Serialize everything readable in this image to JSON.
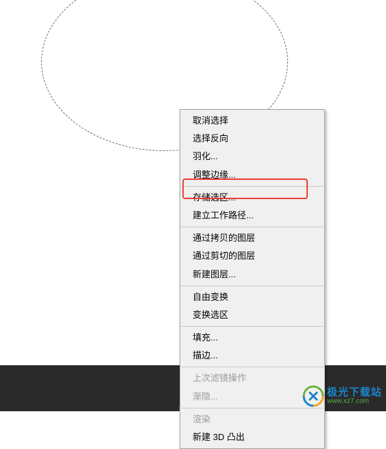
{
  "menu": {
    "items": [
      {
        "label": "取消选择",
        "disabled": false
      },
      {
        "label": "选择反向",
        "disabled": false
      },
      {
        "label": "羽化...",
        "disabled": false
      },
      {
        "label": "调整边缘...",
        "disabled": false
      },
      {
        "sep": true
      },
      {
        "label": "存储选区...",
        "disabled": false
      },
      {
        "label": "建立工作路径...",
        "disabled": false,
        "highlighted": true
      },
      {
        "sep": true
      },
      {
        "label": "通过拷贝的图层",
        "disabled": false
      },
      {
        "label": "通过剪切的图层",
        "disabled": false
      },
      {
        "label": "新建图层...",
        "disabled": false
      },
      {
        "sep": true
      },
      {
        "label": "自由变换",
        "disabled": false
      },
      {
        "label": "变换选区",
        "disabled": false
      },
      {
        "sep": true
      },
      {
        "label": "填充...",
        "disabled": false
      },
      {
        "label": "描边...",
        "disabled": false
      },
      {
        "sep": true
      },
      {
        "label": "上次滤镜操作",
        "disabled": true
      },
      {
        "label": "渐隐...",
        "disabled": true
      },
      {
        "sep": true
      },
      {
        "label": "渲染",
        "disabled": true
      },
      {
        "label": "新建 3D 凸出",
        "disabled": false
      }
    ]
  },
  "watermark": {
    "title": "极光下载站",
    "url": "www.xz7.com"
  }
}
